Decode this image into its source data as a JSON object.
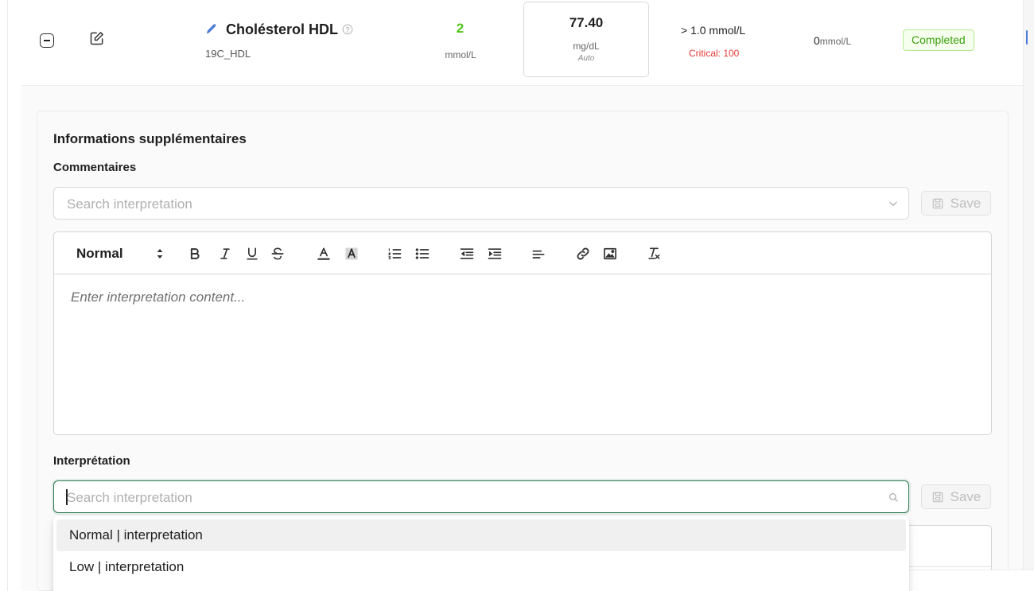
{
  "result": {
    "test_name": "Cholésterol HDL",
    "test_code": "19C_HDL",
    "value": "2",
    "value_unit": "mmol/L",
    "converted_value": "77.40",
    "converted_unit": "mg/dL",
    "converted_mode": "Auto",
    "reference_range": "> 1.0 mmol/L",
    "critical": "Critical: 100",
    "previous_value": "0",
    "previous_unit": "mmol/L",
    "status": "Completed"
  },
  "colors": {
    "value_green": "#52c41a",
    "critical_red": "#e53935",
    "status_green": "#389e0d",
    "focus_green": "#2e7d52",
    "icon_blue": "#4c7bd9"
  },
  "panel": {
    "title": "Informations supplémentaires",
    "comments": {
      "label": "Commentaires",
      "placeholder": "Search interpretation",
      "save_label": "Save"
    },
    "editor": {
      "format": "Normal",
      "placeholder": "Enter interpretation content...",
      "tools": [
        "bold-icon",
        "italic-icon",
        "underline-icon",
        "strikethrough-icon",
        "text-color-icon",
        "background-color-icon",
        "ordered-list-icon",
        "bullet-list-icon",
        "outdent-icon",
        "indent-icon",
        "align-icon",
        "link-icon",
        "image-icon",
        "clear-format-icon"
      ]
    },
    "interpretation": {
      "label": "Interprétation",
      "placeholder": "Search interpretation",
      "save_label": "Save",
      "options": [
        "Normal | interpretation",
        "Low | interpretation"
      ]
    }
  }
}
